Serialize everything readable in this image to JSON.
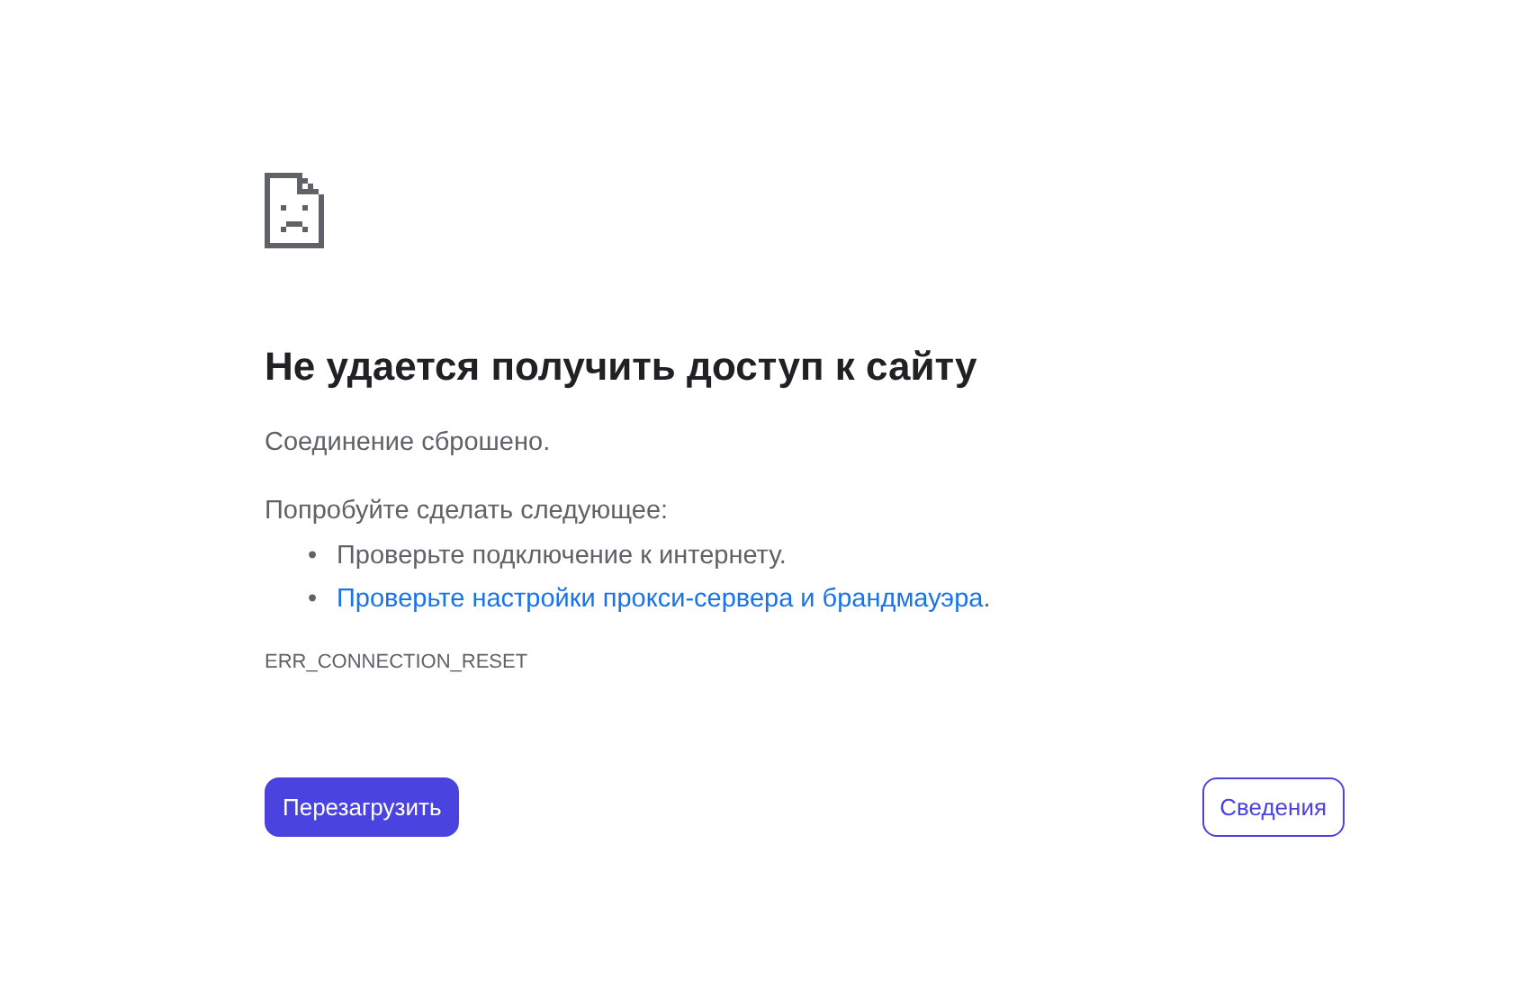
{
  "title": "Не удается получить доступ к сайту",
  "message": "Соединение сброшено.",
  "suggestions_heading": "Попробуйте сделать следующее:",
  "suggestions": [
    {
      "kind": "text",
      "bullet": "•",
      "text": "Проверьте подключение к интернету."
    },
    {
      "kind": "link",
      "bullet": "•",
      "text": "Проверьте настройки прокси-сервера и брандмауэра",
      "suffix": "."
    }
  ],
  "error_code": "ERR_CONNECTION_RESET",
  "buttons": {
    "reload": "Перезагрузить",
    "details": "Сведения"
  }
}
